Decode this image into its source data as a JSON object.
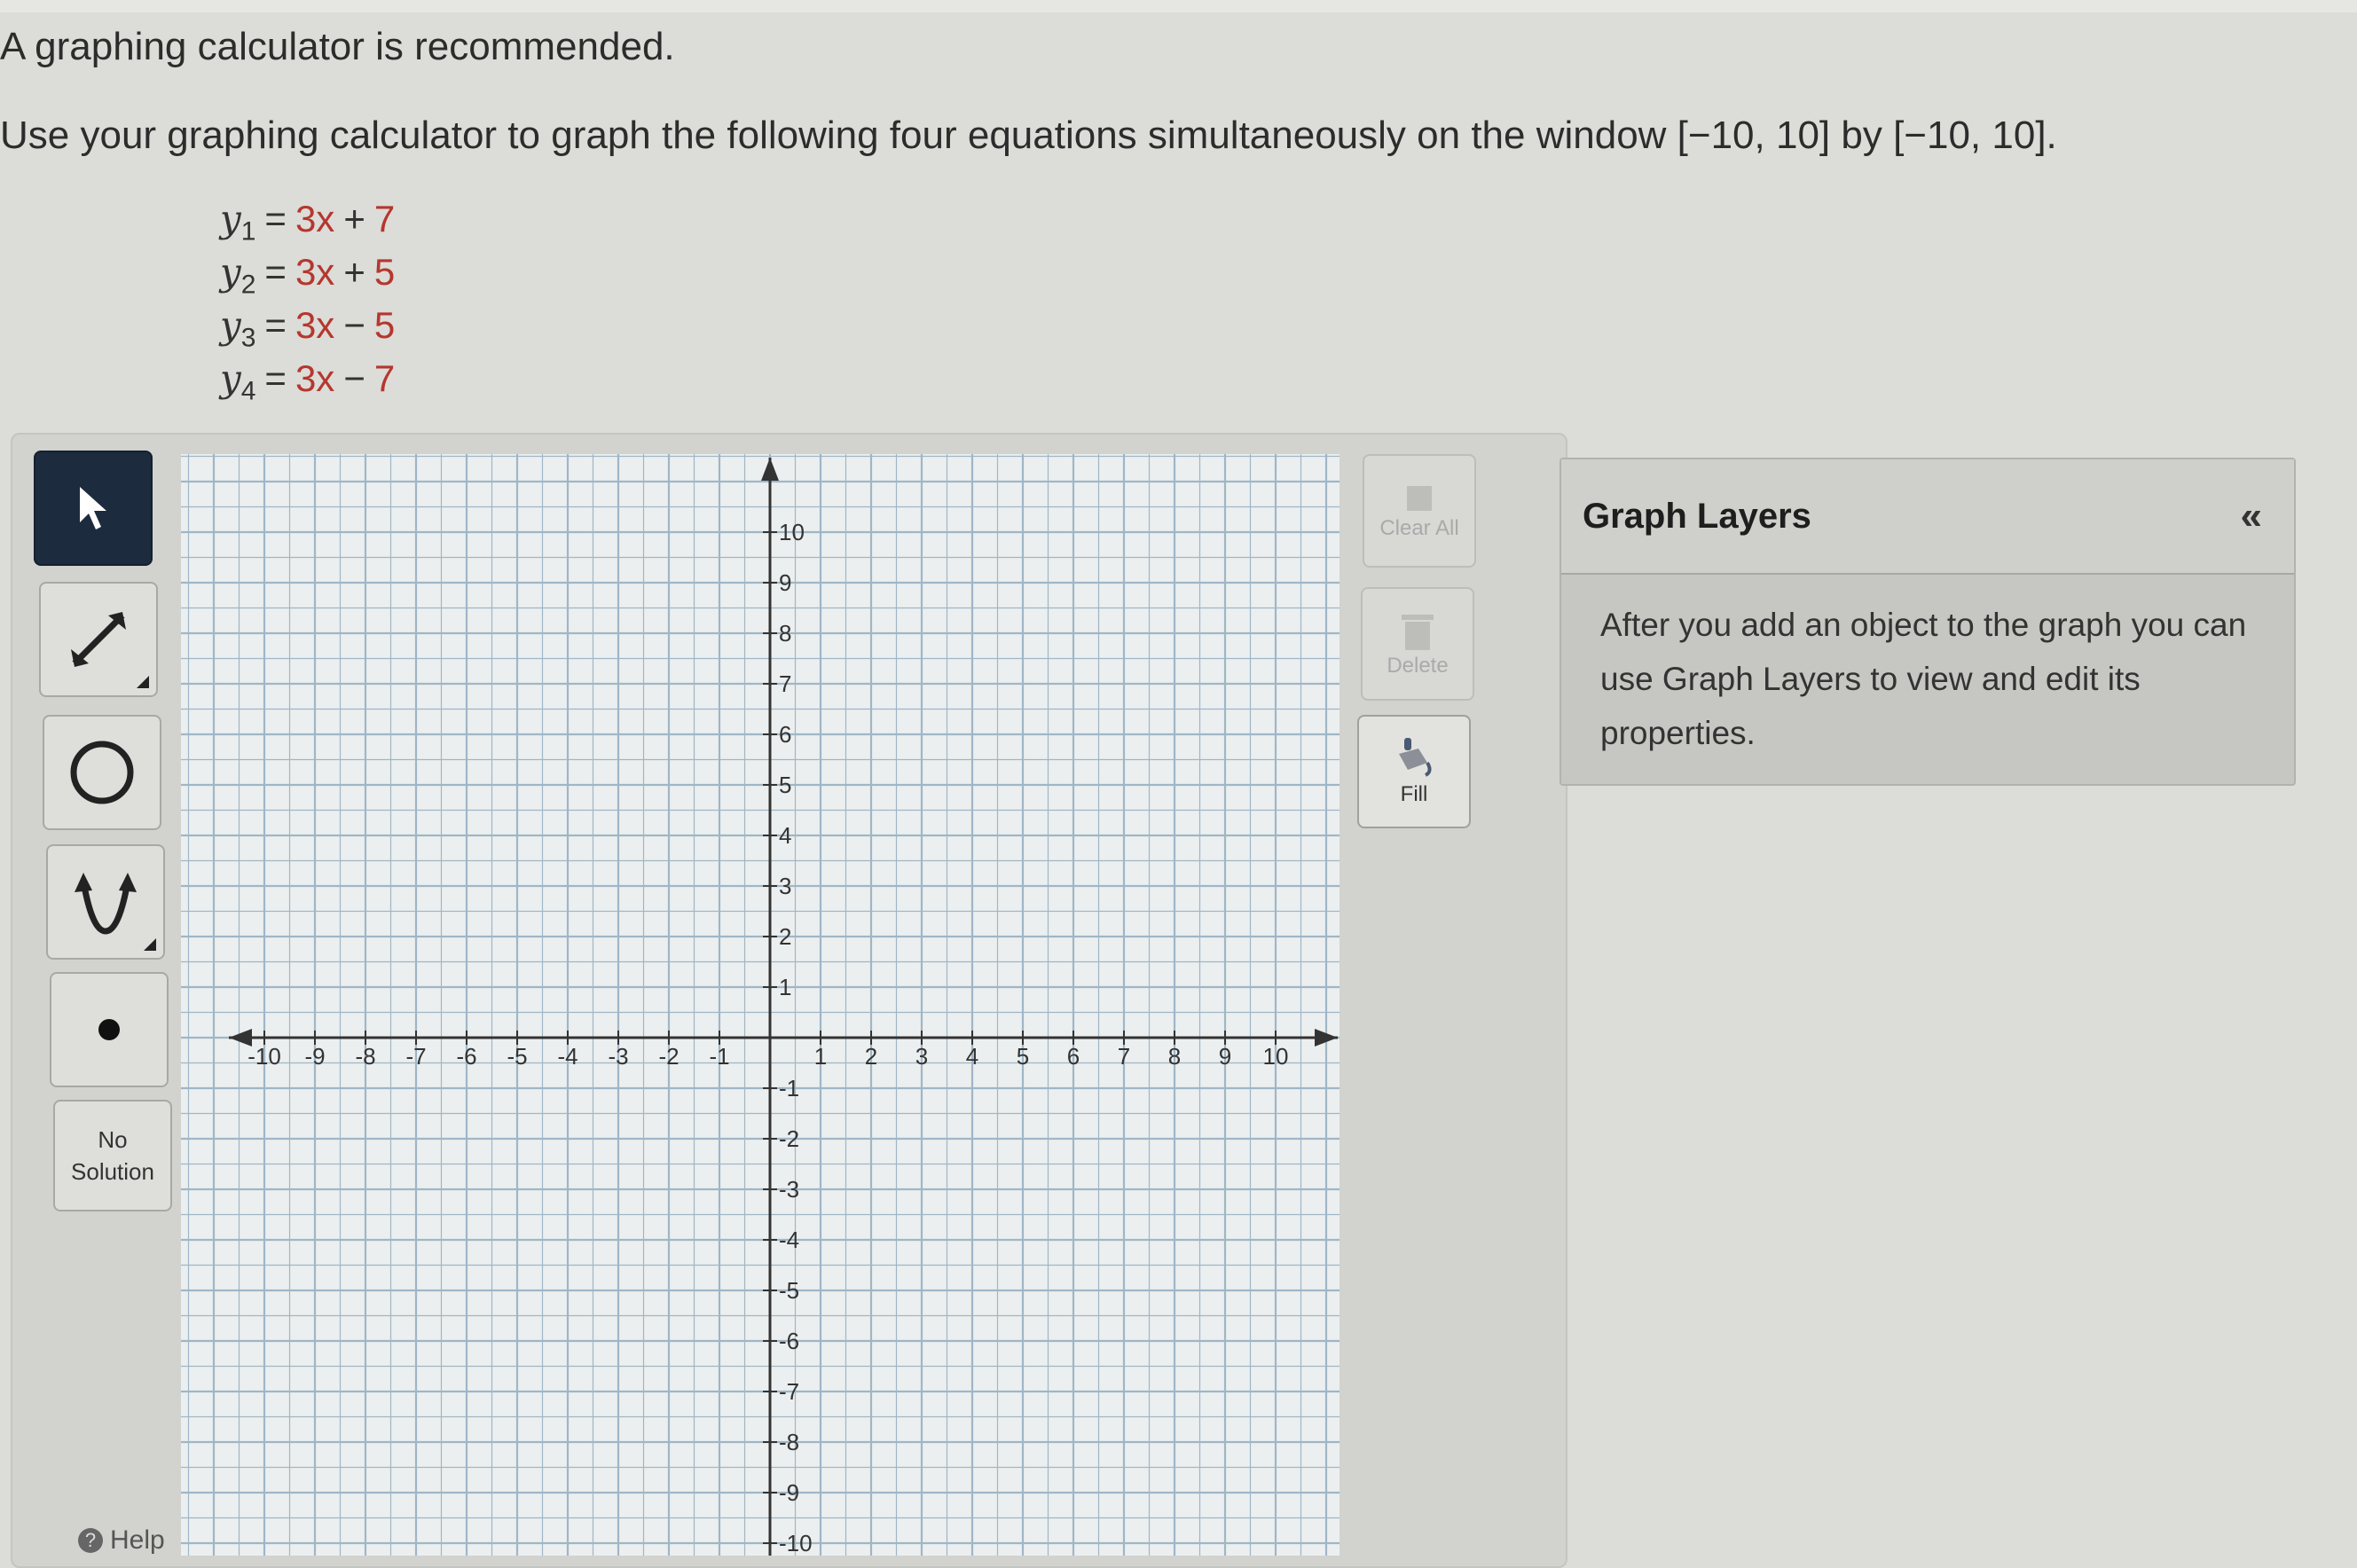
{
  "intro": "A graphing calculator is recommended.",
  "instruction": "Use your graphing calculator to graph the following four equations simultaneously on the window [−10, 10] by [−10, 10].",
  "equations": [
    {
      "var": "y",
      "sub": "1",
      "coef": "3x",
      "op": "+",
      "const": "7"
    },
    {
      "var": "y",
      "sub": "2",
      "coef": "3x",
      "op": "+",
      "const": "5"
    },
    {
      "var": "y",
      "sub": "3",
      "coef": "3x",
      "op": "−",
      "const": "5"
    },
    {
      "var": "y",
      "sub": "4",
      "coef": "3x",
      "op": "−",
      "const": "7"
    }
  ],
  "equals_sign": "=",
  "tools": {
    "pointer_icon": "cursor-arrow-icon",
    "line_icon": "line-segment-icon",
    "circle_icon": "circle-icon",
    "parabola_icon": "parabola-icon",
    "point_icon": "point-icon",
    "no_solution_line1": "No",
    "no_solution_line2": "Solution"
  },
  "help_label": "Help",
  "side_buttons": {
    "clear_all_label": "Clear All",
    "delete_label": "Delete",
    "fill_label": "Fill"
  },
  "layers": {
    "title": "Graph Layers",
    "collapse_glyph": "«",
    "body": "After you add an object to the graph you can use Graph Layers to view and edit its properties."
  },
  "colors": {
    "accent_dark": "#1d2b3e",
    "constant_red": "#b5372f",
    "grid_blue": "#9fb6c7"
  },
  "graph": {
    "xmin": -10,
    "xmax": 10,
    "ymin": -10,
    "ymax": 10,
    "x_ticks": [
      "-10",
      "-9",
      "-8",
      "-7",
      "-6",
      "-5",
      "-4",
      "-3",
      "-2",
      "-1",
      "1",
      "2",
      "3",
      "4",
      "5",
      "6",
      "7",
      "8",
      "9",
      "10"
    ],
    "y_ticks": [
      "10",
      "9",
      "8",
      "7",
      "6",
      "5",
      "4",
      "3",
      "2",
      "1",
      "-1",
      "-2",
      "-3",
      "-4",
      "-5",
      "-6",
      "-7",
      "-8",
      "-9",
      "-10"
    ]
  }
}
